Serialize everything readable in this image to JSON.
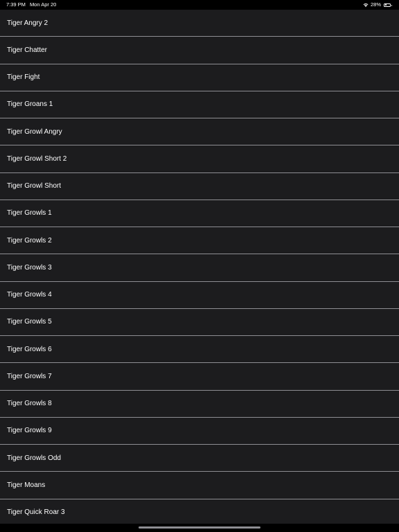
{
  "status_bar": {
    "time": "7:39 PM",
    "date": "Mon Apr 20",
    "battery_percent": "28%",
    "battery_level": 0.28,
    "icons": [
      "wifi-icon",
      "battery-icon"
    ]
  },
  "sounds": [
    "Tiger Angry 2",
    "Tiger Chatter",
    "Tiger Fight",
    "Tiger Groans 1",
    "Tiger Growl Angry",
    "Tiger Growl Short 2",
    "Tiger Growl Short",
    "Tiger Growls 1",
    "Tiger Growls 2",
    "Tiger Growls 3",
    "Tiger Growls 4",
    "Tiger Growls 5",
    "Tiger Growls 6",
    "Tiger Growls 7",
    "Tiger Growls 8",
    "Tiger Growls 9",
    "Tiger Growls Odd",
    "Tiger Moans",
    "Tiger Quick Roar 3"
  ],
  "colors": {
    "background": "#000000",
    "cell": "#1c1c1e",
    "separator": "#8e8e93",
    "text": "#ffffff"
  }
}
